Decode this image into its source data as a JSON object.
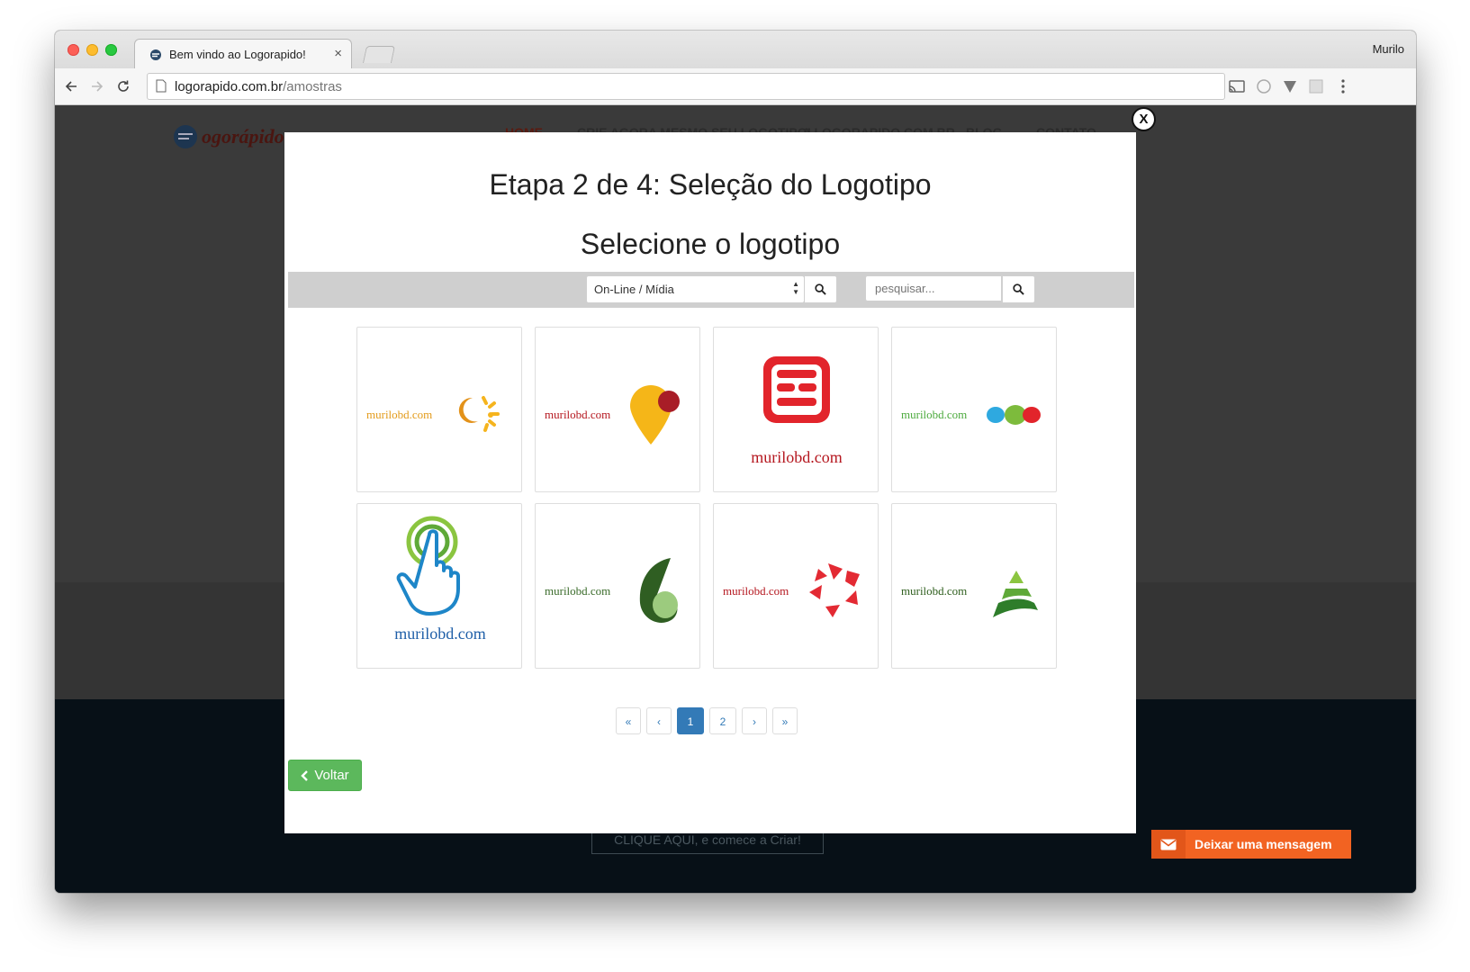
{
  "browser": {
    "tab_title": "Bem vindo ao Logorapido!",
    "tab_close": "×",
    "profile_name": "Murilo",
    "url_domain": "logorapido.com.br",
    "url_path": "/amostras"
  },
  "site": {
    "logo_text": "ogorápido",
    "nav": [
      "HOME",
      "CRIE AGORA MESMO SEU LOGOTIPO!",
      "A LOGORAPIDO.COM.BR",
      "BLOG",
      "CONTATO"
    ],
    "cta": "CLIQUE AQUI, e comece a Criar!"
  },
  "modal": {
    "close_label": "X",
    "step_title": "Etapa 2 de 4: Seleção do Logotipo",
    "subtitle": "Selecione o logotipo",
    "category_select": "On-Line / Mídia",
    "search_placeholder": "pesquisar...",
    "logos": [
      {
        "text": "murilobd.com",
        "color": "#e39b1b",
        "icon": "sun-moon-icon"
      },
      {
        "text": "murilobd.com",
        "color": "#b5171f",
        "icon": "map-pin-icon"
      },
      {
        "text": "murilobd.com",
        "color": "#b5171f",
        "icon": "red-e-monogram-icon"
      },
      {
        "text": "murilobd.com",
        "color": "#4caa3d",
        "icon": "three-dots-icon"
      },
      {
        "text": "murilobd.com",
        "color": "#1f5fa8",
        "icon": "touch-hand-icon"
      },
      {
        "text": "murilobd.com",
        "color": "#3a6b2a",
        "icon": "leaf-seed-icon"
      },
      {
        "text": "murilobd.com",
        "color": "#b5171f",
        "icon": "red-star-icon"
      },
      {
        "text": "murilobd.com",
        "color": "#2e5e1d",
        "icon": "tree-triangle-icon"
      }
    ],
    "pagination": {
      "first": "«",
      "prev": "‹",
      "pages": [
        "1",
        "2"
      ],
      "current": "1",
      "next": "›",
      "last": "»"
    },
    "back_button": "Voltar"
  },
  "chat_widget": {
    "label": "Deixar uma mensagem"
  },
  "colors": {
    "primary": "#337ab7",
    "success": "#5cb85c",
    "chat": "#f26322"
  }
}
